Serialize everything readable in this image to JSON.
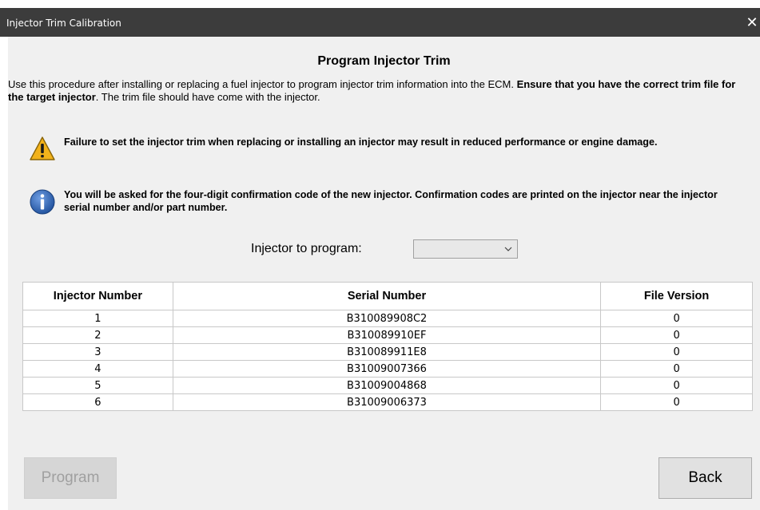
{
  "window": {
    "title": "Injector Trim Calibration",
    "close_glyph": "✕"
  },
  "content": {
    "heading": "Program Injector Trim",
    "intro_plain": "Use this procedure after installing or replacing a fuel injector to program injector trim information into the ECM. ",
    "intro_bold": "Ensure that you have the correct trim file for the target injector",
    "intro_tail": ". The trim file should have come with the injector.",
    "warning_text": "Failure to set the injector trim when replacing or installing an injector may result in reduced performance or engine damage.",
    "info_text": "You will be asked for the four-digit confirmation code of the new injector. Confirmation codes are printed on the injector near the injector serial number and/or part number.",
    "warning_icon": "warning-icon",
    "info_icon": "info-icon"
  },
  "injector_select": {
    "label": "Injector to program:",
    "value": ""
  },
  "table": {
    "headers": [
      "Injector Number",
      "Serial Number",
      "File Version"
    ],
    "rows": [
      [
        "1",
        "B310089908C2",
        "0"
      ],
      [
        "2",
        "B310089910EF",
        "0"
      ],
      [
        "3",
        "B310089911E8",
        "0"
      ],
      [
        "4",
        "B31009007366",
        "0"
      ],
      [
        "5",
        "B31009004868",
        "0"
      ],
      [
        "6",
        "B31009006373",
        "0"
      ]
    ]
  },
  "buttons": {
    "program": "Program",
    "back": "Back"
  },
  "colors": {
    "titlebar": "#3c3c3c",
    "window_bg": "#f0f0f0",
    "warning_yellow": "#f2b21b",
    "info_blue": "#2a5caa"
  }
}
